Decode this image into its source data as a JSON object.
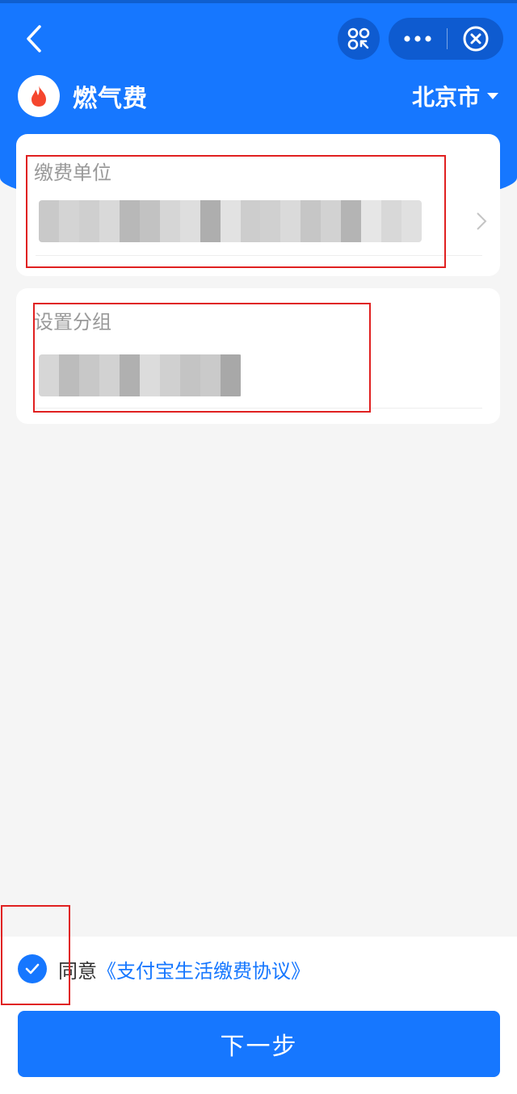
{
  "header": {
    "title": "燃气费",
    "city": "北京市"
  },
  "form": {
    "unit_label": "缴费单位",
    "group_label": "设置分组"
  },
  "agreement": {
    "prefix": "同意",
    "link": "《支付宝生活缴费协议》",
    "checked": true
  },
  "next_button": "下一步",
  "colors": {
    "primary": "#1677ff",
    "annotation": "#e02020",
    "label_gray": "#999999"
  },
  "icons": {
    "back": "back-icon",
    "scan": "mini-program-icon",
    "more": "more-icon",
    "close": "close-icon",
    "logo": "flame-icon",
    "caret": "caret-down-icon",
    "chevron": "chevron-right-icon",
    "check": "check-icon"
  }
}
